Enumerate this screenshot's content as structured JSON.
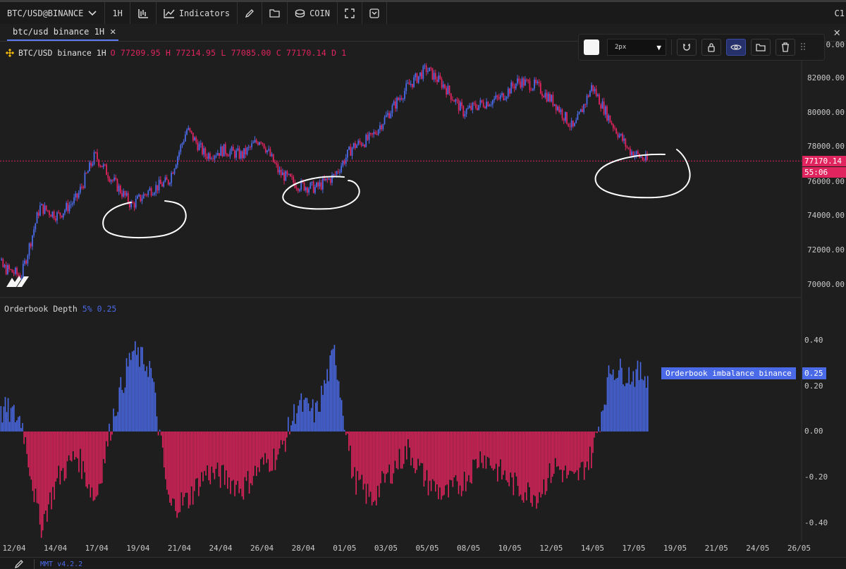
{
  "topbar": {
    "symbol": "BTC/USD@BINANCE",
    "interval": "1H",
    "indicators_label": "Indicators",
    "coin_label": "COIN",
    "right_label": "C1"
  },
  "tab": {
    "label": "btc/usd binance 1H"
  },
  "legend": {
    "symbol": "BTC/USD binance 1H",
    "ohlc": "O 77209.95 H 77214.95 L 77085.00 C 77170.14 D 1"
  },
  "drawing_toolbar": {
    "width_value": "2px",
    "swatch_color": "#f5f5f5"
  },
  "price_axis": {
    "ticks": [
      "82000.00",
      "80000.00",
      "78000.00",
      "76000.00",
      "74000.00",
      "72000.00",
      "70000.00"
    ],
    "top_partial": "0.00",
    "last_price": "77170.14",
    "countdown": "55:06"
  },
  "indicator": {
    "name": "Orderbook Depth",
    "param_pct": "5%",
    "param_val": "0.25",
    "ticks": [
      "0.40",
      "0.20",
      "0.00",
      "-0.20",
      "-0.40"
    ],
    "series_label": "Orderbook imbalance binance",
    "series_value": "0.25"
  },
  "time_axis": [
    "12/04",
    "14/04",
    "17/04",
    "19/04",
    "21/04",
    "24/04",
    "26/04",
    "28/04",
    "01/05",
    "03/05",
    "05/05",
    "08/05",
    "10/05",
    "12/05",
    "14/05",
    "17/05",
    "19/05",
    "21/05",
    "24/05",
    "26/05"
  ],
  "bottombar": {
    "version": "MMT v4.2.2"
  },
  "colors": {
    "up": "#4a6ae8",
    "down": "#e0245e",
    "background": "#1e1e1e"
  },
  "chart_data": [
    {
      "type": "line",
      "x": [
        "11/04",
        "12/04",
        "13/04",
        "14/04",
        "15/04",
        "16/04",
        "17/04",
        "18/04",
        "19/04",
        "20/04",
        "21/04",
        "22/04",
        "23/04",
        "24/04",
        "25/04",
        "26/04",
        "27/04",
        "28/04",
        "29/04",
        "30/04",
        "01/05",
        "02/05",
        "03/05",
        "04/05",
        "05/05",
        "06/05",
        "07/05",
        "08/05",
        "09/05",
        "10/05",
        "11/05",
        "12/05",
        "13/05",
        "14/05",
        "15/05",
        "16/05",
        "17/05"
      ],
      "series": [
        {
          "values": [
            73000,
            71000,
            70500,
            74500,
            74000,
            75000,
            77500,
            76000,
            74600,
            75500,
            76000,
            79000,
            77500,
            77800,
            77500,
            78500,
            76500,
            75800,
            75600,
            76300,
            78000,
            78500,
            80000,
            81500,
            82500,
            81500,
            80000,
            80500,
            80800,
            81800,
            81500,
            80500,
            79000,
            81500,
            79500,
            77800,
            77170
          ]
        }
      ],
      "ylim": [
        69000,
        83500
      ],
      "ytick_labels": [
        "82000.00",
        "80000.00",
        "78000.00",
        "76000.00",
        "74000.00",
        "72000.00",
        "70000.00"
      ],
      "last_price": 77170.14,
      "annotations": [
        "freehand circle near 19/04 low",
        "freehand circle near 28/04 low",
        "freehand circle near 17/05 price"
      ]
    },
    {
      "type": "bar",
      "title": "Orderbook Depth",
      "x": [
        "11/04",
        "12/04",
        "13/04",
        "14/04",
        "15/04",
        "16/04",
        "17/04",
        "18/04",
        "19/04",
        "20/04",
        "21/04",
        "22/04",
        "23/04",
        "24/04",
        "25/04",
        "26/04",
        "27/04",
        "28/04",
        "29/04",
        "30/04",
        "01/05",
        "02/05",
        "03/05",
        "04/05",
        "05/05",
        "06/05",
        "07/05",
        "08/05",
        "09/05",
        "10/05",
        "11/05",
        "12/05",
        "13/05",
        "14/05",
        "15/05",
        "16/05",
        "17/05"
      ],
      "series": [
        {
          "name": "Orderbook imbalance binance",
          "values": [
            -0.15,
            0.1,
            0.05,
            -0.42,
            -0.2,
            -0.1,
            -0.3,
            0.08,
            0.35,
            0.28,
            -0.33,
            -0.3,
            -0.18,
            -0.2,
            -0.25,
            -0.15,
            -0.1,
            0.12,
            0.08,
            0.35,
            -0.2,
            -0.3,
            -0.18,
            -0.08,
            -0.22,
            -0.28,
            -0.22,
            -0.1,
            -0.18,
            -0.25,
            -0.28,
            -0.15,
            -0.22,
            -0.1,
            0.28,
            0.25,
            0.25
          ]
        }
      ],
      "ylim": [
        -0.45,
        0.45
      ],
      "ytick_labels": [
        "0.40",
        "0.20",
        "0.00",
        "-0.20",
        "-0.40"
      ],
      "last_value": 0.25
    }
  ]
}
